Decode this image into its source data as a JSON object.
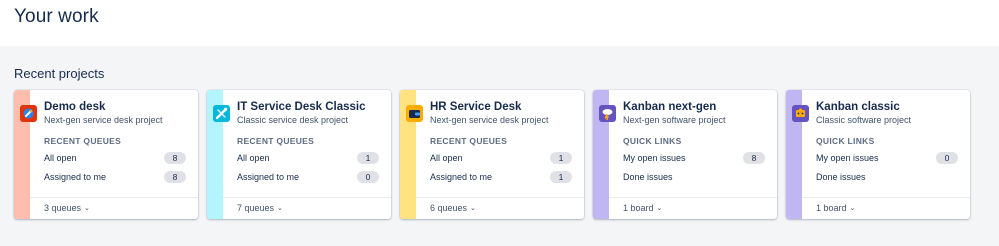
{
  "page": {
    "title": "Your work"
  },
  "section": {
    "title": "Recent projects"
  },
  "projects": [
    {
      "name": "Demo desk",
      "type": "Next-gen service desk project",
      "stripe_color": "#ffbdad",
      "icon": "rocket-icon",
      "icon_bg": "#de350b",
      "section_label": "RECENT QUEUES",
      "rows": [
        {
          "label": "All open",
          "count": "8"
        },
        {
          "label": "Assigned to me",
          "count": "8"
        }
      ],
      "footer": "3 queues"
    },
    {
      "name": "IT Service Desk Classic",
      "type": "Classic service desk project",
      "stripe_color": "#b3f5ff",
      "icon": "tools-icon",
      "icon_bg": "#00b8d9",
      "section_label": "RECENT QUEUES",
      "rows": [
        {
          "label": "All open",
          "count": "1"
        },
        {
          "label": "Assigned to me",
          "count": "0"
        }
      ],
      "footer": "7 queues"
    },
    {
      "name": "HR Service Desk",
      "type": "Next-gen service desk project",
      "stripe_color": "#ffe380",
      "icon": "wallet-icon",
      "icon_bg": "#ffab00",
      "section_label": "RECENT QUEUES",
      "rows": [
        {
          "label": "All open",
          "count": "1"
        },
        {
          "label": "Assigned to me",
          "count": "1"
        }
      ],
      "footer": "6 queues"
    },
    {
      "name": "Kanban next-gen",
      "type": "Next-gen software project",
      "stripe_color": "#c0b6f2",
      "icon": "cloud-lightning-icon",
      "icon_bg": "#6554c0",
      "section_label": "QUICK LINKS",
      "rows": [
        {
          "label": "My open issues",
          "count": "8"
        },
        {
          "label": "Done issues",
          "count": ""
        }
      ],
      "footer": "1 board"
    },
    {
      "name": "Kanban classic",
      "type": "Classic software project",
      "stripe_color": "#c0b6f2",
      "icon": "puzzle-icon",
      "icon_bg": "#6554c0",
      "section_label": "QUICK LINKS",
      "rows": [
        {
          "label": "My open issues",
          "count": "0"
        },
        {
          "label": "Done issues",
          "count": ""
        }
      ],
      "footer": "1 board"
    }
  ]
}
